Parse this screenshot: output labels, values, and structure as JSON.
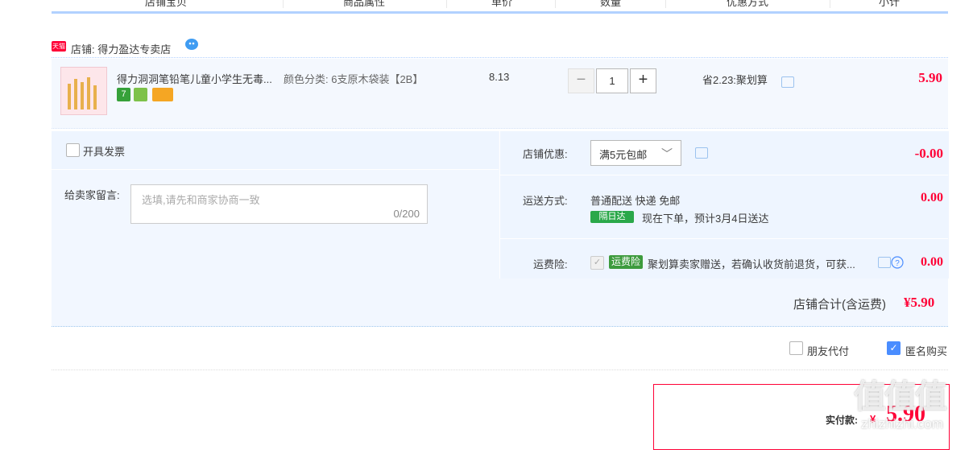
{
  "header": {
    "cols": [
      "店铺宝贝",
      "商品属性",
      "单价",
      "数量",
      "优惠方式",
      "小计"
    ]
  },
  "shop": {
    "badge": "天猫",
    "name": "店铺: 得力盈达专卖店"
  },
  "item": {
    "title": "得力洞洞笔铅笔儿童小学生无毒...",
    "badges": [
      "7",
      "",
      ""
    ],
    "attr": "颜色分类: 6支原木袋装【2B】",
    "price": "8.13",
    "qty_minus": "−",
    "qty": "1",
    "qty_plus": "+",
    "discount": "省2.23:聚划算",
    "subtotal": "5.90"
  },
  "invoice": {
    "label": "开具发票"
  },
  "message": {
    "label": "给卖家留言:",
    "placeholder": "选填,请先和商家协商一致",
    "count": "0/200"
  },
  "shop_promo": {
    "label": "店铺优惠:",
    "selected": "满5元包邮",
    "amount": "-0.00"
  },
  "shipping": {
    "label": "运送方式:",
    "method": "普通配送 快递 免邮",
    "next_day_badge": "隔日达",
    "eta": "现在下单，预计3月4日送达",
    "amount": "0.00"
  },
  "insurance": {
    "label": "运费险:",
    "badge": "运费险",
    "desc": "聚划算卖家赠送，若确认收货前退货，可获...",
    "amount": "0.00"
  },
  "shop_total": {
    "label": "店铺合计(含运费)",
    "amount": "¥5.90"
  },
  "options": {
    "friend_pay": "朋友代付",
    "anonymous": "匿名购买"
  },
  "pay": {
    "label": "实付款:",
    "currency": "¥",
    "amount": "5.90"
  },
  "watermark": {
    "text": "值值值",
    "sub": "zhizhizhi.com"
  },
  "colors": {
    "accent_red": "#ff0036",
    "panel_blue": "#f2f7ff",
    "check_blue": "#4a8dff",
    "badge_green": "#28a745"
  }
}
